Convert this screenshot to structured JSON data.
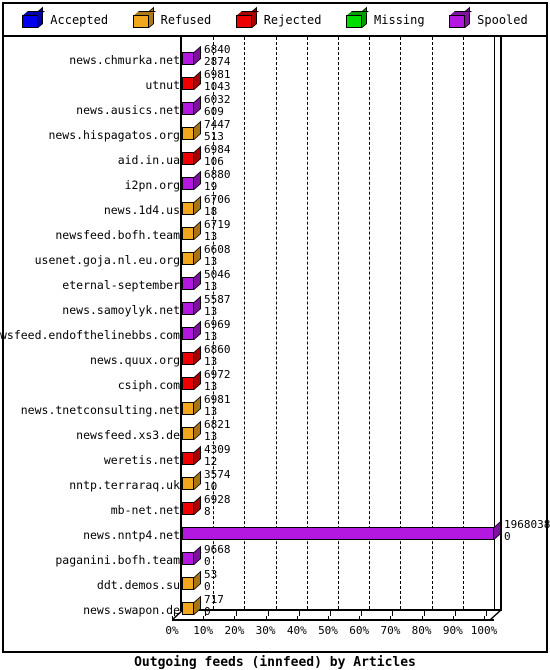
{
  "legend": {
    "items": [
      {
        "label": "Accepted",
        "color": "#0000ee",
        "icon": "cube-icon"
      },
      {
        "label": "Refused",
        "color": "#f0a71e",
        "icon": "cube-icon"
      },
      {
        "label": "Rejected",
        "color": "#ee0000",
        "icon": "cube-icon"
      },
      {
        "label": "Missing",
        "color": "#00dd00",
        "icon": "cube-icon"
      },
      {
        "label": "Spooled",
        "color": "#b218e0",
        "icon": "cube-icon"
      }
    ]
  },
  "chart_data": {
    "type": "bar",
    "orientation": "horizontal",
    "title": "Outgoing feeds (innfeed) by Articles",
    "xlabel": "",
    "ylabel": "",
    "xlim": [
      0,
      100
    ],
    "xticks": [
      "0%",
      "10%",
      "20%",
      "30%",
      "40%",
      "50%",
      "60%",
      "70%",
      "80%",
      "90%",
      "100%"
    ],
    "xtick_values": [
      0,
      10,
      20,
      30,
      40,
      50,
      60,
      70,
      80,
      90,
      100
    ],
    "grid": true,
    "grid_style": "dashed-vertical",
    "legend_position": "top",
    "value_unit": "articles",
    "max_value": 19680380,
    "categories": [
      "news.chmurka.net",
      "utnut",
      "news.ausics.net",
      "news.hispagatos.org",
      "aid.in.ua",
      "i2pn.org",
      "news.1d4.us",
      "newsfeed.bofh.team",
      "usenet.goja.nl.eu.org",
      "eternal-september",
      "news.samoylyk.net",
      "newsfeed.endofthelinebbs.com",
      "news.quux.org",
      "csiph.com",
      "news.tnetconsulting.net",
      "newsfeed.xs3.de",
      "weretis.net",
      "nntp.terraraq.uk",
      "mb-net.net",
      "news.nntp4.net",
      "paganini.bofh.team",
      "ddt.demos.su",
      "news.swapon.de"
    ],
    "values": [
      68402874,
      69811043,
      6032609,
      7447513,
      6984106,
      688019,
      670618,
      671913,
      660813,
      504613,
      558713,
      696913,
      686013,
      697213,
      698113,
      682113,
      430912,
      357410,
      69288,
      19680380,
      96680,
      530,
      7170
    ],
    "bars": [
      {
        "category": "news.chmurka.net",
        "value_line1": "6840",
        "value_line2": "2874",
        "percent": 0.35,
        "color_key": "Spooled"
      },
      {
        "category": "utnut",
        "value_line1": "6981",
        "value_line2": "1043",
        "percent": 0.35,
        "color_key": "Rejected"
      },
      {
        "category": "news.ausics.net",
        "value_line1": "6032",
        "value_line2": "609",
        "percent": 0.35,
        "color_key": "Spooled"
      },
      {
        "category": "news.hispagatos.org",
        "value_line1": "7447",
        "value_line2": "513",
        "percent": 0.35,
        "color_key": "Refused"
      },
      {
        "category": "aid.in.ua",
        "value_line1": "6984",
        "value_line2": "106",
        "percent": 0.35,
        "color_key": "Rejected"
      },
      {
        "category": "i2pn.org",
        "value_line1": "6880",
        "value_line2": "19",
        "percent": 0.35,
        "color_key": "Spooled"
      },
      {
        "category": "news.1d4.us",
        "value_line1": "6706",
        "value_line2": "18",
        "percent": 0.35,
        "color_key": "Refused"
      },
      {
        "category": "newsfeed.bofh.team",
        "value_line1": "6719",
        "value_line2": "13",
        "percent": 0.35,
        "color_key": "Refused"
      },
      {
        "category": "usenet.goja.nl.eu.org",
        "value_line1": "6608",
        "value_line2": "13",
        "percent": 0.35,
        "color_key": "Refused"
      },
      {
        "category": "eternal-september",
        "value_line1": "5046",
        "value_line2": "13",
        "percent": 0.35,
        "color_key": "Spooled"
      },
      {
        "category": "news.samoylyk.net",
        "value_line1": "5587",
        "value_line2": "13",
        "percent": 0.35,
        "color_key": "Spooled"
      },
      {
        "category": "newsfeed.endofthelinebbs.com",
        "value_line1": "6969",
        "value_line2": "13",
        "percent": 0.35,
        "color_key": "Spooled"
      },
      {
        "category": "news.quux.org",
        "value_line1": "6860",
        "value_line2": "13",
        "percent": 0.35,
        "color_key": "Rejected"
      },
      {
        "category": "csiph.com",
        "value_line1": "6972",
        "value_line2": "13",
        "percent": 0.35,
        "color_key": "Rejected"
      },
      {
        "category": "news.tnetconsulting.net",
        "value_line1": "6981",
        "value_line2": "13",
        "percent": 0.35,
        "color_key": "Refused"
      },
      {
        "category": "newsfeed.xs3.de",
        "value_line1": "6821",
        "value_line2": "13",
        "percent": 0.35,
        "color_key": "Refused"
      },
      {
        "category": "weretis.net",
        "value_line1": "4309",
        "value_line2": "12",
        "percent": 0.35,
        "color_key": "Rejected"
      },
      {
        "category": "nntp.terraraq.uk",
        "value_line1": "3574",
        "value_line2": "10",
        "percent": 0.35,
        "color_key": "Refused"
      },
      {
        "category": "mb-net.net",
        "value_line1": "6928",
        "value_line2": "8",
        "percent": 0.35,
        "color_key": "Rejected"
      },
      {
        "category": "news.nntp4.net",
        "value_line1": "1968038",
        "value_line2": "0",
        "percent": 100,
        "color_key": "Spooled"
      },
      {
        "category": "paganini.bofh.team",
        "value_line1": "9668",
        "value_line2": "0",
        "percent": 0.35,
        "color_key": "Spooled"
      },
      {
        "category": "ddt.demos.su",
        "value_line1": "53",
        "value_line2": "0",
        "percent": 0.35,
        "color_key": "Refused"
      },
      {
        "category": "news.swapon.de",
        "value_line1": "717",
        "value_line2": "0",
        "percent": 0.35,
        "color_key": "Refused"
      }
    ]
  }
}
